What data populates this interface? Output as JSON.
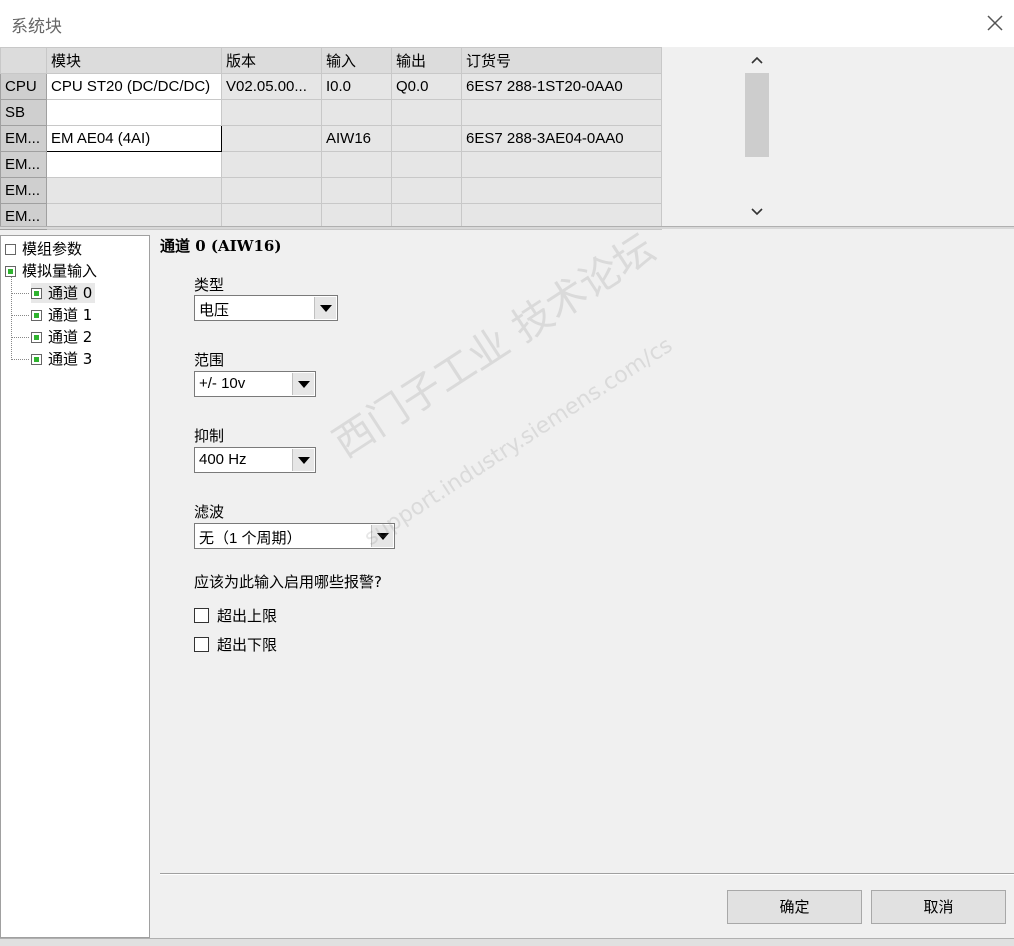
{
  "window": {
    "title": "系统块"
  },
  "modules": {
    "headers": [
      "",
      "模块",
      "版本",
      "输入",
      "输出",
      "订货号"
    ],
    "rows": [
      {
        "slot": "CPU",
        "module": "CPU ST20 (DC/DC/DC)",
        "version": "V02.05.00...",
        "input": "I0.0",
        "output": "Q0.0",
        "order": "6ES7 288-1ST20-0AA0"
      },
      {
        "slot": "SB",
        "module": "",
        "version": "",
        "input": "",
        "output": "",
        "order": ""
      },
      {
        "slot": "EM...",
        "module": "EM AE04 (4AI)",
        "version": "",
        "input": "AIW16",
        "output": "",
        "order": "6ES7 288-3AE04-0AA0"
      },
      {
        "slot": "EM...",
        "module": "",
        "version": "",
        "input": "",
        "output": "",
        "order": ""
      },
      {
        "slot": "EM...",
        "module": "",
        "version": "",
        "input": "",
        "output": "",
        "order": ""
      },
      {
        "slot": "EM...",
        "module": "",
        "version": "",
        "input": "",
        "output": "",
        "order": ""
      }
    ]
  },
  "tree": {
    "items": [
      {
        "label": "模组参数",
        "checked": false
      },
      {
        "label": "模拟量输入",
        "checked": true
      },
      {
        "label": "通道 0",
        "checked": true
      },
      {
        "label": "通道 1",
        "checked": true
      },
      {
        "label": "通道 2",
        "checked": true
      },
      {
        "label": "通道 3",
        "checked": true
      }
    ]
  },
  "panel": {
    "heading": "通道 0 (AIW16)",
    "type_label": "类型",
    "type_value": "电压",
    "range_label": "范围",
    "range_value": "+/- 10v",
    "reject_label": "抑制",
    "reject_value": "400 Hz",
    "filter_label": "滤波",
    "filter_value": "无（1 个周期）",
    "alarm_question": "应该为此输入启用哪些报警?",
    "upper_limit": "超出上限",
    "lower_limit": "超出下限"
  },
  "watermark": {
    "line1": "西门子工业 技术论坛",
    "line2": "support.industry.siemens.com/cs"
  },
  "buttons": {
    "ok": "确定",
    "cancel": "取消"
  }
}
